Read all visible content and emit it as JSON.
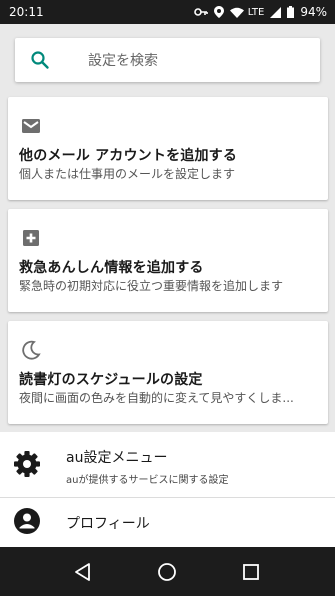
{
  "status_bar": {
    "time": "20:11",
    "network": "LTE",
    "battery": "94%",
    "icons": [
      "key-icon",
      "location-icon",
      "wifi-icon",
      "signal-icon",
      "battery-icon"
    ]
  },
  "search": {
    "placeholder": "設定を検索",
    "icon": "search-icon",
    "accent_color": "#00897b"
  },
  "suggestion_cards": [
    {
      "icon": "mail-icon",
      "title": "他のメール アカウントを追加する",
      "subtitle": "個人または仕事用のメールを設定します"
    },
    {
      "icon": "medical-plus-icon",
      "title": "救急あんしん情報を追加する",
      "subtitle": "緊急時の初期対応に役立つ重要情報を追加します"
    },
    {
      "icon": "moon-icon",
      "title": "読書灯のスケジュールの設定",
      "subtitle": "夜間に画面の色みを自動的に変えて見やすくしま..."
    }
  ],
  "settings_list": [
    {
      "icon": "gear-icon",
      "title": "au設定メニュー",
      "subtitle": "auが提供するサービスに関する設定"
    },
    {
      "icon": "account-icon",
      "title": "プロフィール"
    }
  ],
  "nav_bar": {
    "buttons": [
      "back-button",
      "home-button",
      "recents-button"
    ]
  }
}
